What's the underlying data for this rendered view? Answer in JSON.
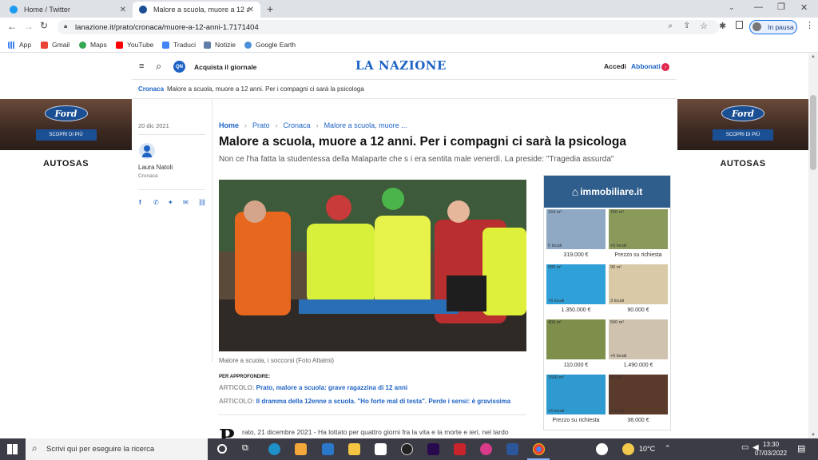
{
  "browser": {
    "tabs": [
      {
        "title": "Home / Twitter",
        "active": false
      },
      {
        "title": "Malore a scuola, muore a 12 anni. ...",
        "active": true
      }
    ],
    "new_tab_symbol": "+",
    "url": "lanazione.it/prato/cronaca/muore-a-12-anni-1.7171404",
    "profile_label": "In pausa",
    "bookmarks": [
      "App",
      "Gmail",
      "Maps",
      "YouTube",
      "Traduci",
      "Notizie",
      "Google Earth"
    ]
  },
  "site": {
    "logo": "LA NAZIONE",
    "qn_badge": "QN",
    "acquista": "Acquista il giornale",
    "accedi": "Accedi",
    "abbonati": "Abbonati",
    "subnav_section": "Cronaca",
    "subnav_title": "Malore a scuola, muore a 12 anni. Per i compagni ci sarà la psicologa"
  },
  "side_ads": {
    "brand": "Ford",
    "cta": "SCOPRI DI PIÙ",
    "dealer": "AUTOSAS"
  },
  "article": {
    "date": "20 dic 2021",
    "author": "Laura Natoli",
    "author_section": "Cronaca",
    "breadcrumb": [
      "Home",
      "Prato",
      "Cronaca",
      "Malore a scuola, muore ..."
    ],
    "title": "Malore a scuola, muore a 12 anni. Per i compagni ci sarà la psicologa",
    "subtitle": "Non ce l'ha fatta la studentessa della Malaparte che s i era sentita male venerdì. La preside: \"Tragedia assurda\"",
    "photo_caption": "Malore a scuola, i soccorsi (Foto Attalmi)",
    "related_heading": "PER APPROFONDIRE:",
    "related": [
      {
        "tag": "ARTICOLO:",
        "text": "Prato, malore a scuola: grave ragazzina di 12 anni"
      },
      {
        "tag": "ARTICOLO:",
        "text": "Il dramma della 12enne a scuola. \"Ho forte mal di testa\". Perde i sensi: è gravissima"
      }
    ],
    "body_dropcap": "P",
    "body_start": "rato, 21 dicembre 2021 - Ha lottato per quattro giorni fra la vita e la morte e ieri, nel tardo"
  },
  "immobiliare_ad": {
    "brand": "immobiliare.it",
    "listings": [
      {
        "sqm": "164 m²",
        "rooms": "5 locali",
        "price": "319.000 €"
      },
      {
        "sqm": "750 m²",
        "rooms": "+5 locali",
        "price": "Prezzo su richiesta"
      },
      {
        "sqm": "580 m²",
        "rooms": "+5 locali",
        "price": "1.350.000 €"
      },
      {
        "sqm": "90 m²",
        "rooms": "3 locali",
        "price": "90.000 €"
      },
      {
        "sqm": "400 m²",
        "rooms": "",
        "price": "110.000 €"
      },
      {
        "sqm": "500 m²",
        "rooms": "+5 locali",
        "price": "1.490.000 €"
      },
      {
        "sqm": "1500 m²",
        "rooms": "+5 locali",
        "price": "Prezzo su richiesta"
      },
      {
        "sqm": "54 m²",
        "rooms": "2 locali",
        "price": "38.000 €"
      }
    ]
  },
  "taskbar": {
    "search_placeholder": "Scrivi qui per eseguire la ricerca",
    "temperature": "10°C",
    "time": "13:30",
    "date": "07/03/2022"
  },
  "colors": {
    "brand_blue": "#1e63c4",
    "abbonati_red": "#e2264d",
    "immobiliare_blue": "#2f5e8c"
  }
}
